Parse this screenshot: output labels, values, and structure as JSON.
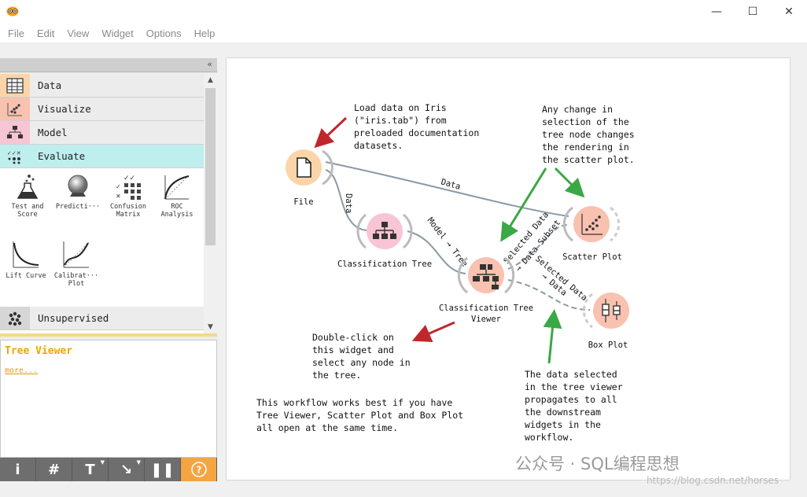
{
  "window": {
    "controls": {
      "minimize": "—",
      "maximize": "☐",
      "close": "✕"
    }
  },
  "menu": [
    "File",
    "Edit",
    "View",
    "Widget",
    "Options",
    "Help"
  ],
  "toolbox": {
    "collapse_glyph": "«",
    "categories": {
      "data": "Data",
      "visualize": "Visualize",
      "model": "Model",
      "evaluate": "Evaluate",
      "unsupervised": "Unsupervised"
    },
    "evaluate_widgets": [
      {
        "label_line1": "Test and",
        "label_line2": "Score",
        "icon": "flask-icon"
      },
      {
        "label_line1": "Predicti···",
        "label_line2": "",
        "icon": "crystal-ball-icon"
      },
      {
        "label_line1": "Confusion",
        "label_line2": "Matrix",
        "icon": "confusion-matrix-icon"
      },
      {
        "label_line1": "ROC",
        "label_line2": "Analysis",
        "icon": "roc-curve-icon"
      },
      {
        "label_line1": "Lift Curve",
        "label_line2": "",
        "icon": "lift-curve-icon"
      },
      {
        "label_line1": "Calibrat···",
        "label_line2": "Plot",
        "icon": "calibration-plot-icon"
      }
    ],
    "scroll_up": "▲",
    "scroll_down": "▼"
  },
  "help_panel": {
    "title": "Tree Viewer",
    "more_link": "more..."
  },
  "bottom_toolbar": {
    "info": "i",
    "grid": "#",
    "text": "T",
    "arrow": "↘",
    "pause": "❚❚",
    "help": "?"
  },
  "canvas": {
    "nodes": {
      "file": "File",
      "classification_tree": "Classification Tree",
      "tree_viewer_line1": "Classification Tree",
      "tree_viewer_line2": "Viewer",
      "scatter_plot": "Scatter Plot",
      "box_plot": "Box Plot"
    },
    "links": {
      "file_to_scatter": "Data",
      "file_to_tree": "Data",
      "tree_to_viewer": "Model → Tree",
      "viewer_to_scatter_1": "Selected Data",
      "viewer_to_scatter_2": "→ Data Subset",
      "viewer_to_box_1": "Selected Data",
      "viewer_to_box_2": "→ Data"
    },
    "annotations": {
      "load_data": "Load data on Iris\n(\"iris.tab\") from\npreloaded documentation\ndatasets.",
      "selection_change": "Any change in\nselection of the\ntree node changes\nthe rendering in\nthe scatter plot.",
      "double_click": "Double-click on\nthis widget and\nselect any node in\nthe tree.",
      "workflow_best": "This workflow works best if you have\nTree Viewer, Scatter Plot and Box Plot\nall open at the same time.",
      "data_selected": "The data selected\nin the tree viewer\npropagates to all\nthe downstream\nwidgets in the\nworkflow."
    },
    "colors": {
      "data_node": "#fbd5a8",
      "model_node": "#f7c5d4",
      "visualize_node": "#f9c1b0",
      "red_arrow": "#c0272d",
      "green_arrow": "#3aa845"
    }
  },
  "watermark": {
    "text": "公众号 · SQL编程思想",
    "url": "https://blog.csdn.net/horses"
  }
}
